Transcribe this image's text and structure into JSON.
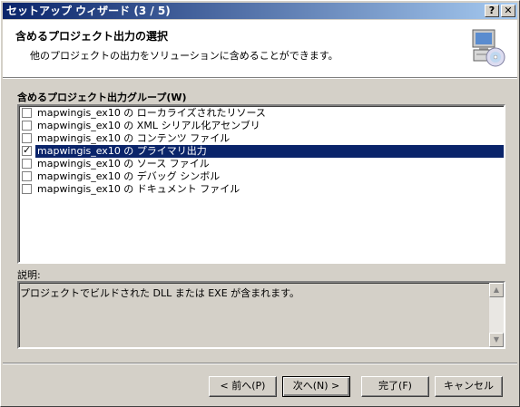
{
  "window": {
    "title": "セットアップ ウィザード (3 / 5)",
    "help_label": "?",
    "close_label": "✕"
  },
  "header": {
    "title": "含めるプロジェクト出力の選択",
    "subtitle": "他のプロジェクトの出力をソリューションに含めることができます。",
    "icon": "setup-computer-cd-icon"
  },
  "output_groups": {
    "label": "含めるプロジェクト出力グループ(W)",
    "items": [
      {
        "label": "mapwingis_ex10 の ローカライズされたリソース",
        "checked": false
      },
      {
        "label": "mapwingis_ex10 の XML シリアル化アセンブリ",
        "checked": false
      },
      {
        "label": "mapwingis_ex10 の コンテンツ ファイル",
        "checked": false
      },
      {
        "label": "mapwingis_ex10 の プライマリ出力",
        "checked": true,
        "selected": true
      },
      {
        "label": "mapwingis_ex10 の ソース ファイル",
        "checked": false
      },
      {
        "label": "mapwingis_ex10 の デバッグ シンボル",
        "checked": false
      },
      {
        "label": "mapwingis_ex10 の ドキュメント ファイル",
        "checked": false
      }
    ]
  },
  "description": {
    "label": "説明:",
    "text": "プロジェクトでビルドされた DLL または EXE が含まれます。"
  },
  "buttons": {
    "back": "< 前へ(P)",
    "next": "次へ(N) >",
    "finish": "完了(F)",
    "cancel": "キャンセル"
  },
  "colors": {
    "selection": "#0a246a",
    "face": "#d4d0c8"
  }
}
